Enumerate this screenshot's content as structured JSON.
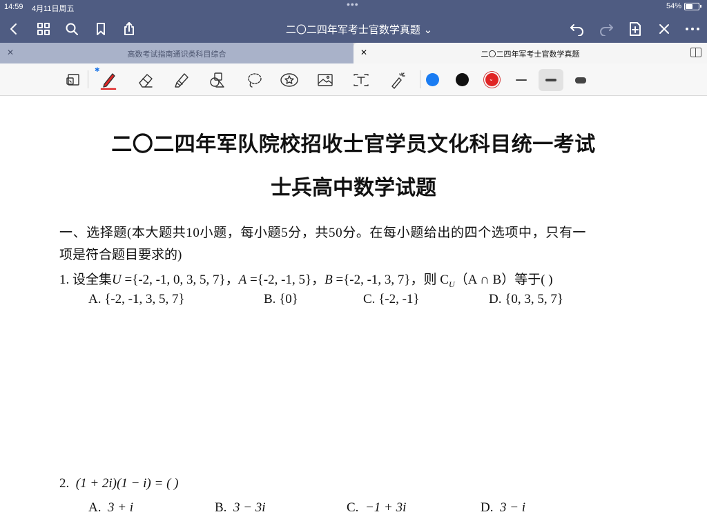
{
  "status_bar": {
    "time": "14:59",
    "date": "4月11日周五",
    "battery_text": "54%",
    "battery_level": 0.54
  },
  "nav": {
    "title": "二〇二四年军考士官数学真题 ⌄",
    "icons": [
      "back-icon",
      "grid-icon",
      "search-icon",
      "bookmark-icon",
      "share-icon",
      "undo-icon",
      "redo-icon",
      "add-page-icon",
      "close-icon",
      "more-icon"
    ]
  },
  "tabs": [
    {
      "label": "高数考试指南通识类科目综合",
      "active": false
    },
    {
      "label": "二〇二四年军考士官数学真题",
      "active": true
    }
  ],
  "toolbar": {
    "tools": [
      "page-select-icon",
      "pen-icon",
      "eraser-icon",
      "highlighter-icon",
      "shapes-icon",
      "lasso-icon",
      "sticker-icon",
      "image-icon",
      "text-icon",
      "laser-pointer-icon"
    ],
    "bluetooth_mark": "✱",
    "colors": [
      "#1a7cf2",
      "#111111",
      "#e02424"
    ],
    "selected_color": "#e02424",
    "stroke_widths": [
      "thin",
      "medium",
      "thick"
    ],
    "selected_width": "medium"
  },
  "document": {
    "title": "二〇二四年军队院校招收士官学员文化科目统一考试",
    "subtitle": "士兵高中数学试题",
    "section_line1": "一、选择题(本大题共10小题，每小题5分，共50分。在每小题给出的四个选项中，只有一",
    "section_line2": "项是符合题目要求的)",
    "q1": {
      "number": "1.",
      "prefix": "设全集",
      "U": "U",
      "u_set": " ={-2, -1, 0, 3, 5, 7}，",
      "A": "A",
      "a_set": " ={-2, -1, 5}，",
      "B": "B",
      "b_set": " ={-2, -1, 3, 7}，则 ",
      "complement": "C",
      "complement_sub": "U",
      "complement_expr": "（A ∩ B）等于(        )",
      "options": [
        {
          "label": "A.",
          "text": "{-2, -1, 3, 5, 7}"
        },
        {
          "label": "B.",
          "text": "{0}"
        },
        {
          "label": "C.",
          "text": "{-2, -1}"
        },
        {
          "label": "D.",
          "text": "{0, 3, 5, 7}"
        }
      ]
    },
    "q2": {
      "number": "2.",
      "expr": "(1 + 2i)(1 − i) = (        )",
      "options": [
        {
          "label": "A.",
          "text": "3 + i"
        },
        {
          "label": "B.",
          "text": "3 − 3i"
        },
        {
          "label": "C.",
          "text": "−1 + 3i"
        },
        {
          "label": "D.",
          "text": "3 − i"
        }
      ]
    }
  }
}
